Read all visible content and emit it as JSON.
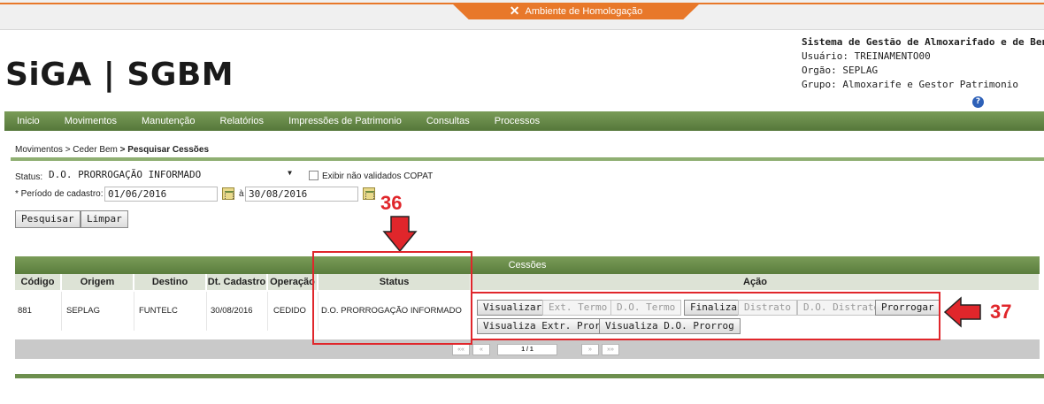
{
  "env": {
    "label": "Ambiente de Homologação",
    "icon": "tools-icon"
  },
  "logo": "SiGA | SGBM",
  "system": {
    "title": "Sistema de Gestão de Almoxarifado e de Bens",
    "user": "Usuário: TREINAMENTO00",
    "org": "Orgão: SEPLAG",
    "group": "Grupo: Almoxarife e Gestor Patrimonio",
    "help_icon": "help-icon"
  },
  "nav": [
    "Inicio",
    "Movimentos",
    "Manutenção",
    "Relatórios",
    "Impressões de Patrimonio",
    "Consultas",
    "Processos"
  ],
  "breadcrumb": {
    "part1": "Movimentos",
    "part2": "> Ceder Bem",
    "current": "> Pesquisar Cessões"
  },
  "form": {
    "status_label": "Status:",
    "status_value": "D.O. PRORROGAÇÃO INFORMADO",
    "checkbox_label": "Exibir não validados COPAT",
    "period_label": "* Período de cadastro:",
    "date_from": "01/06/2016",
    "date_sep": "à",
    "date_to": "30/08/2016",
    "search_button": "Pesquisar",
    "clear_button": "Limpar"
  },
  "annotations": {
    "a36": "36",
    "a37": "37"
  },
  "table": {
    "title": "Cessões",
    "columns": [
      "Código",
      "Origem",
      "Destino",
      "Dt. Cadastro",
      "Operação",
      "Status",
      "Ação"
    ],
    "row": {
      "codigo": "881",
      "origem": "SEPLAG",
      "destino": "FUNTELC",
      "dt_cadastro": "30/08/2016",
      "operacao": "CEDIDO",
      "status": "D.O. PRORROGAÇÃO INFORMADO"
    },
    "actions_row1": [
      {
        "label": "Visualizar",
        "enabled": true
      },
      {
        "label": "Ext. Termo",
        "enabled": false
      },
      {
        "label": "D.O. Termo",
        "enabled": false
      },
      {
        "label": "Finalizar",
        "enabled": true
      },
      {
        "label": "Distrato",
        "enabled": false
      },
      {
        "label": "D.O. Distrato",
        "enabled": false
      },
      {
        "label": "Prorrogar",
        "enabled": true
      }
    ],
    "actions_row2": [
      {
        "label": "Visualiza Extr. Prorrog.",
        "enabled": true
      },
      {
        "label": "Visualiza D.O. Prorrog",
        "enabled": true
      }
    ],
    "pager": {
      "first": "««",
      "prev": "«",
      "page": "1 / 1",
      "next": "»",
      "last": "»»"
    }
  }
}
